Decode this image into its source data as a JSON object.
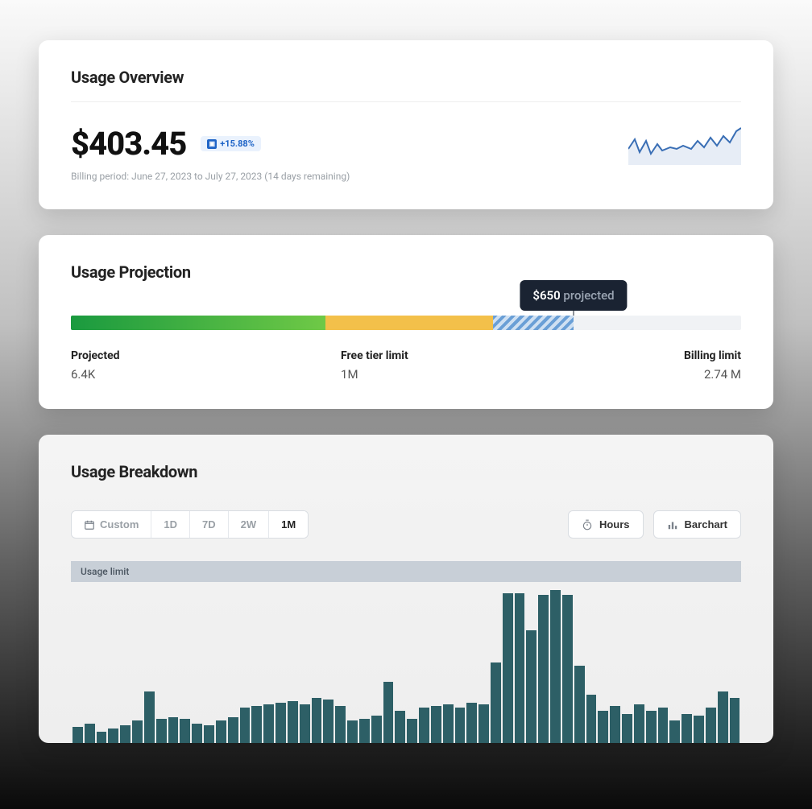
{
  "overview": {
    "title": "Usage Overview",
    "amount": "$403.45",
    "delta": "+15.88%",
    "billing_period": "Billing period: June 27, 2023 to July 27, 2023 (14 days remaining)"
  },
  "projection": {
    "title": "Usage Projection",
    "tooltip_amount": "$650",
    "tooltip_word": "projected",
    "segments": {
      "green_pct": 38,
      "yellow_pct": 25,
      "stripe_pct": 12,
      "tooltip_pct": 75
    },
    "labels": {
      "projected_label": "Projected",
      "projected_value": "6.4K",
      "free_label": "Free tier limit",
      "free_value": "1M",
      "billing_label": "Billing limit",
      "billing_value": "2.74 M"
    }
  },
  "breakdown": {
    "title": "Usage Breakdown",
    "ranges": {
      "custom": "Custom",
      "d1": "1D",
      "d7": "7D",
      "w2": "2W",
      "m1": "1M"
    },
    "active_range": "1M",
    "hours_btn": "Hours",
    "chart_btn": "Barchart",
    "limit_label": "Usage limit"
  },
  "chart_data": {
    "type": "bar",
    "title": "Usage Breakdown",
    "xlabel": "",
    "ylabel": "",
    "ylim": [
      0,
      100
    ],
    "categories": [
      "1",
      "2",
      "3",
      "4",
      "5",
      "6",
      "7",
      "8",
      "9",
      "10",
      "11",
      "12",
      "13",
      "14",
      "15",
      "16",
      "17",
      "18",
      "19",
      "20",
      "21",
      "22",
      "23",
      "24",
      "25",
      "26",
      "27",
      "28",
      "29",
      "30",
      "31",
      "32",
      "33",
      "34",
      "35",
      "36",
      "37",
      "38",
      "39",
      "40",
      "41",
      "42",
      "43",
      "44",
      "45",
      "46",
      "47",
      "48",
      "49",
      "50",
      "51",
      "52",
      "53",
      "54",
      "55",
      "56"
    ],
    "values": [
      10,
      12,
      7,
      9,
      11,
      14,
      32,
      15,
      16,
      15,
      12,
      11,
      14,
      16,
      22,
      23,
      24,
      25,
      26,
      24,
      28,
      27,
      23,
      14,
      15,
      17,
      38,
      20,
      15,
      22,
      23,
      24,
      22,
      25,
      24,
      50,
      93,
      93,
      70,
      92,
      95,
      92,
      48,
      30,
      20,
      23,
      18,
      24,
      20,
      22,
      14,
      18,
      17,
      22,
      32,
      28
    ],
    "usage_limit": 100
  }
}
